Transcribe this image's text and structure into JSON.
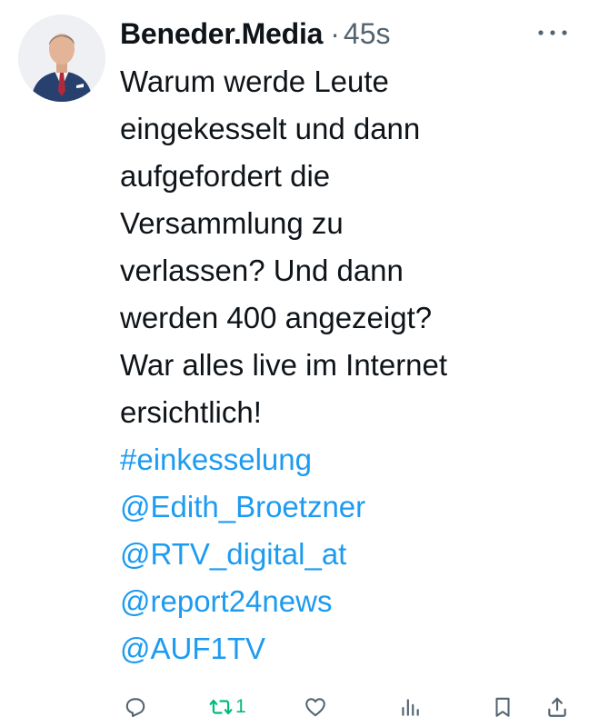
{
  "post": {
    "author_name": "Beneder.Media",
    "separator": "·",
    "timestamp": "45s",
    "text_lines": [
      "Warum werde Leute",
      "eingekesselt und dann",
      "aufgefordert die",
      "Versammlung zu",
      "verlassen? Und dann",
      "werden 400 angezeigt?",
      "War alles live im Internet",
      "ersichtlich!"
    ],
    "links": [
      "#einkesselung",
      "@Edith_Broetzner",
      "@RTV_digital_at",
      "@report24news",
      "@AUF1TV"
    ]
  },
  "actions": {
    "reply": {
      "icon": "reply-icon"
    },
    "repost": {
      "icon": "repost-icon",
      "count": "1",
      "active": true,
      "color": "#00ba7c"
    },
    "like": {
      "icon": "heart-icon"
    },
    "views": {
      "icon": "views-icon"
    },
    "bookmark": {
      "icon": "bookmark-icon"
    },
    "share": {
      "icon": "share-icon"
    }
  },
  "colors": {
    "text": "#0f1419",
    "muted": "#536471",
    "link": "#1d9bf0",
    "repost_active": "#00ba7c"
  }
}
